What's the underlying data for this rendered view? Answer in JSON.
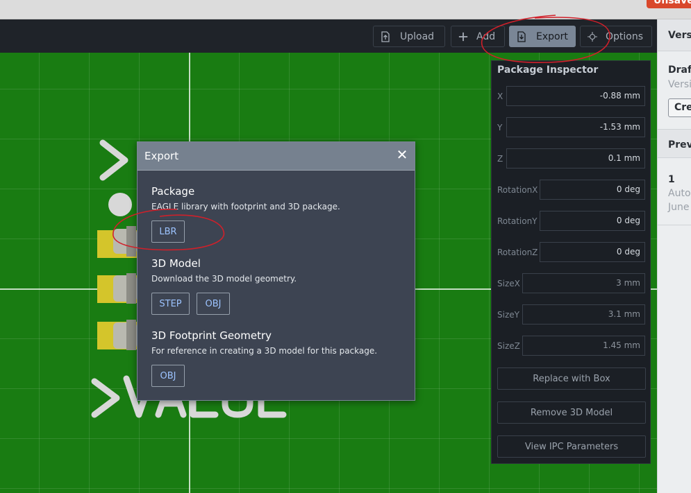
{
  "topbar": {
    "unsaved_badge": "Unsaved"
  },
  "toolbar": {
    "upload_label": "Upload",
    "add_label": "Add",
    "export_label": "Export",
    "options_label": "Options"
  },
  "right_panel": {
    "tab_label": "Versions",
    "draft_title": "Draft",
    "draft_sub": "Version",
    "create_button": "Create",
    "preview_header": "Previous",
    "item_number": "1",
    "item_author": "Auto",
    "item_date": "June"
  },
  "canvas": {
    "silk_top": ">NAME",
    "silk_bottom": ">VALUE"
  },
  "inspector": {
    "title": "Package Inspector",
    "fields": [
      {
        "label": "X",
        "value": "-0.88 mm"
      },
      {
        "label": "Y",
        "value": "-1.53 mm"
      },
      {
        "label": "Z",
        "value": "0.1 mm"
      },
      {
        "label": "RotationX",
        "value": "0 deg"
      },
      {
        "label": "RotationY",
        "value": "0 deg"
      },
      {
        "label": "RotationZ",
        "value": "0 deg"
      },
      {
        "label": "SizeX",
        "value": "3 mm"
      },
      {
        "label": "SizeY",
        "value": "3.1 mm"
      },
      {
        "label": "SizeZ",
        "value": "1.45 mm"
      }
    ],
    "replace_button": "Replace with Box",
    "remove_button": "Remove 3D Model",
    "ipc_button": "View IPC Parameters"
  },
  "export_dialog": {
    "title": "Export",
    "close_glyph": "✕",
    "package": {
      "title": "Package",
      "description": "EAGLE library with footprint and 3D package.",
      "lbr_button": "LBR"
    },
    "model3d": {
      "title": "3D Model",
      "description": "Download the 3D model geometry.",
      "step_button": "STEP",
      "obj_button": "OBJ"
    },
    "footprint": {
      "title": "3D Footprint Geometry",
      "description": "For reference in creating a 3D model for this package.",
      "obj_button": "OBJ"
    }
  },
  "colors": {
    "pcb_green": "#197c12",
    "toolbar_bg": "#1f2329",
    "modal_bg": "#3d4452",
    "modal_header": "#76818f",
    "link_blue": "#9cc3ff",
    "annotation_red": "#d0202a",
    "pad_yellow": "#d4c52b"
  },
  "icons": {
    "upload": "upload-icon",
    "add": "plus-icon",
    "export": "export-file-icon",
    "options": "crosshair-icon",
    "close": "close-icon"
  }
}
